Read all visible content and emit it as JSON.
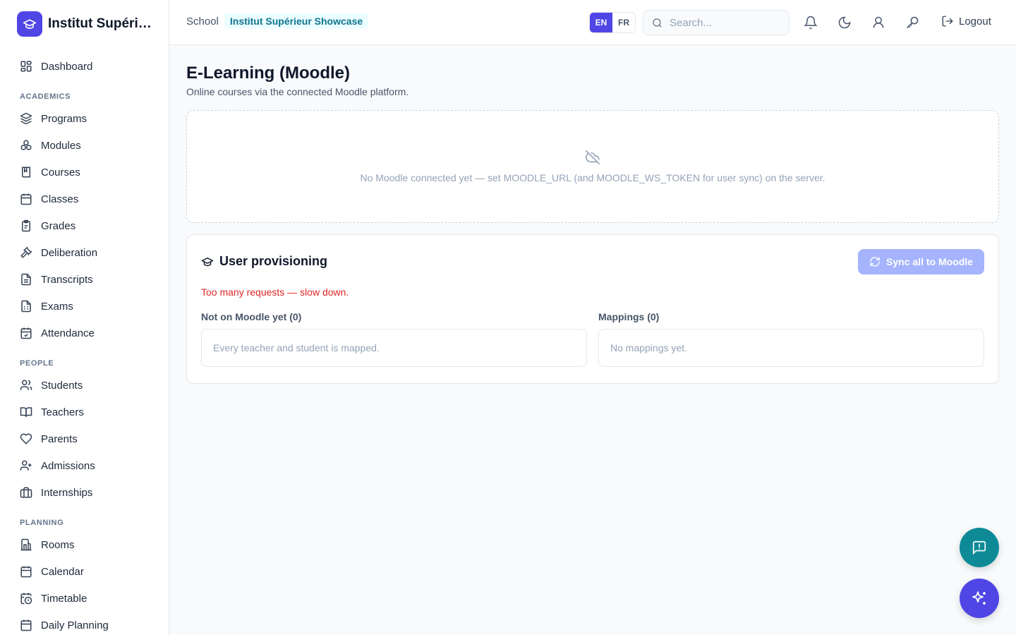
{
  "brand": {
    "name": "Institut Supérieur Showcase",
    "logo_icon": "graduation-cap-icon",
    "accent": "#4f46e5"
  },
  "sidebar": {
    "dashboard": {
      "label": "Dashboard",
      "icon": "grid-icon"
    },
    "sections": [
      {
        "title": "ACADEMICS",
        "items": [
          {
            "label": "Programs",
            "icon": "layers-icon"
          },
          {
            "label": "Modules",
            "icon": "boxes-icon"
          },
          {
            "label": "Courses",
            "icon": "book-icon"
          },
          {
            "label": "Classes",
            "icon": "calendar-icon"
          },
          {
            "label": "Grades",
            "icon": "clipboard-icon"
          },
          {
            "label": "Deliberation",
            "icon": "gavel-icon"
          },
          {
            "label": "Transcripts",
            "icon": "file-text-icon"
          },
          {
            "label": "Exams",
            "icon": "file-spreadsheet-icon"
          },
          {
            "label": "Attendance",
            "icon": "calendar-check-icon"
          }
        ]
      },
      {
        "title": "PEOPLE",
        "items": [
          {
            "label": "Students",
            "icon": "users-icon"
          },
          {
            "label": "Teachers",
            "icon": "book-open-icon"
          },
          {
            "label": "Parents",
            "icon": "heart-icon"
          },
          {
            "label": "Admissions",
            "icon": "user-plus-icon"
          },
          {
            "label": "Internships",
            "icon": "briefcase-icon"
          }
        ]
      },
      {
        "title": "PLANNING",
        "items": [
          {
            "label": "Rooms",
            "icon": "building-icon"
          },
          {
            "label": "Calendar",
            "icon": "calendar-days-icon"
          },
          {
            "label": "Timetable",
            "icon": "calendar-clock-icon"
          },
          {
            "label": "Daily Planning",
            "icon": "calendar-list-icon"
          }
        ]
      }
    ]
  },
  "header": {
    "crumb_school": "School",
    "crumb_tag": "Institut Supérieur Showcase",
    "lang_en": "EN",
    "lang_fr": "FR",
    "search_placeholder": "Search...",
    "logout_label": "Logout"
  },
  "main": {
    "title": "E-Learning (Moodle)",
    "subtitle": "Online courses via the connected Moodle platform.",
    "empty_message": "No Moodle connected yet — set MOODLE_URL (and MOODLE_WS_TOKEN for user sync) on the server.",
    "provisioning": {
      "title": "User provisioning",
      "sync_label": "Sync all to Moodle",
      "error": "Too many requests — slow down.",
      "not_on_moodle_head": "Not on Moodle yet (0)",
      "not_on_moodle_empty": "Every teacher and student is mapped.",
      "mappings_head": "Mappings (0)",
      "mappings_empty": "No mappings yet."
    }
  },
  "colors": {
    "accent": "#4f46e5",
    "teal": "#0e8a97",
    "error": "#dc2626",
    "sync_disabled": "#a5b4fc"
  }
}
